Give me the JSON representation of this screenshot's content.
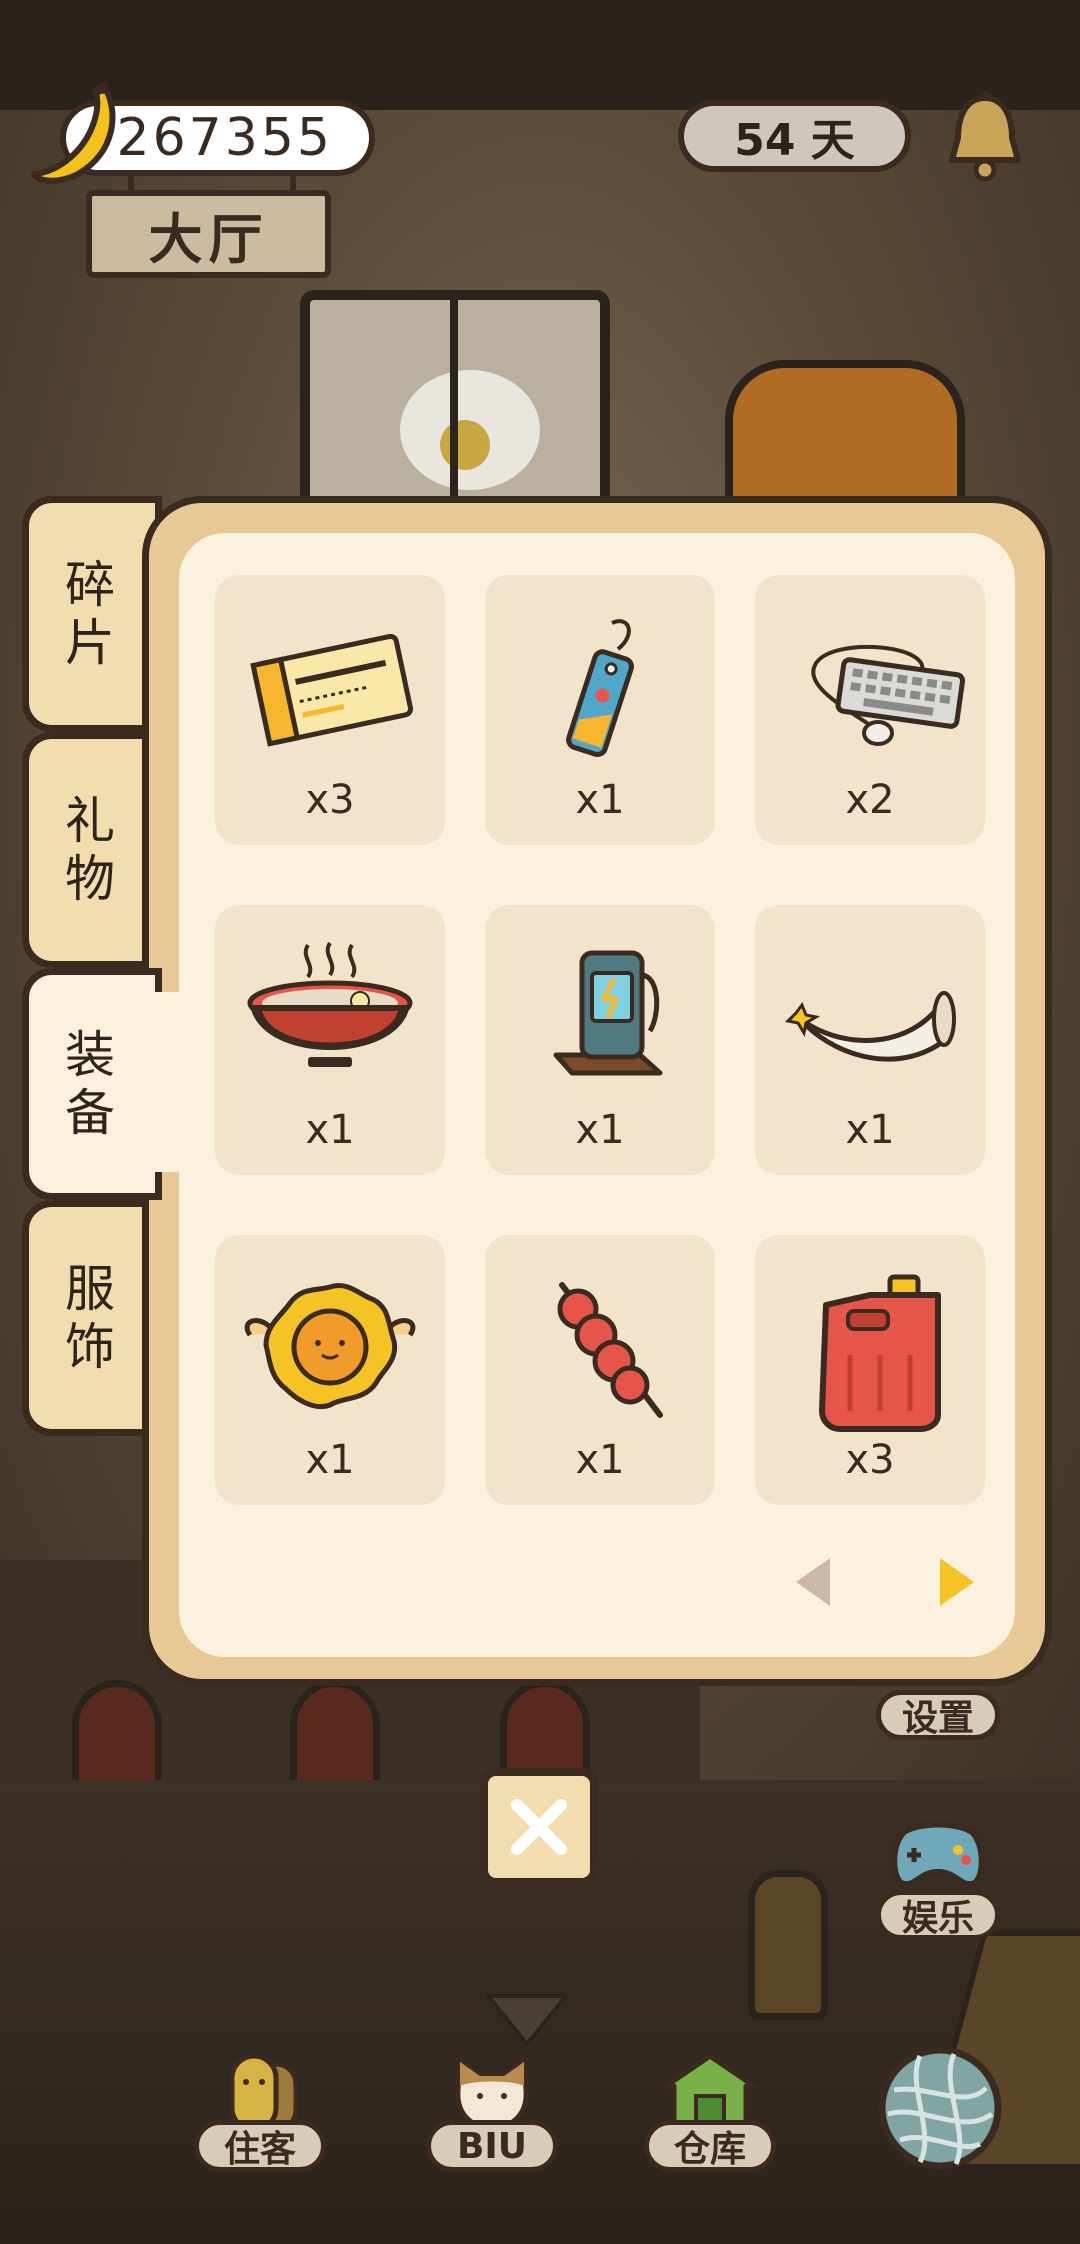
{
  "header": {
    "banana_count": "267355",
    "days": "54 天",
    "room_name": "大厅"
  },
  "inventory": {
    "tabs": [
      {
        "label": "碎片",
        "active": false
      },
      {
        "label": "礼物",
        "active": false
      },
      {
        "label": "装备",
        "active": true
      },
      {
        "label": "服饰",
        "active": false
      }
    ],
    "items": [
      {
        "icon": "ticket-icon",
        "count": "x3"
      },
      {
        "icon": "luggage-tag-icon",
        "count": "x1"
      },
      {
        "icon": "keyboard-icon",
        "count": "x2"
      },
      {
        "icon": "ramen-bowl-icon",
        "count": "x1"
      },
      {
        "icon": "charging-station-icon",
        "count": "x1"
      },
      {
        "icon": "horn-icon",
        "count": "x1"
      },
      {
        "icon": "sun-badge-icon",
        "count": "x1"
      },
      {
        "icon": "skewer-icon",
        "count": "x1"
      },
      {
        "icon": "gas-can-icon",
        "count": "x3"
      }
    ],
    "pagination": {
      "prev_enabled": false,
      "next_enabled": true
    }
  },
  "side_buttons": {
    "settings_label": "设置",
    "entertainment_label": "娱乐"
  },
  "bottom_nav": {
    "residents_label": "住客",
    "biu_label": "BIU",
    "warehouse_label": "仓库"
  },
  "colors": {
    "panel_frame": "#e8c995",
    "panel_inner": "#fbf1df",
    "card_bg": "#f2e3cb",
    "outline": "#3b2a1f",
    "next_arrow": "#f6c324",
    "prev_arrow_disabled": "#cbb9a6"
  }
}
